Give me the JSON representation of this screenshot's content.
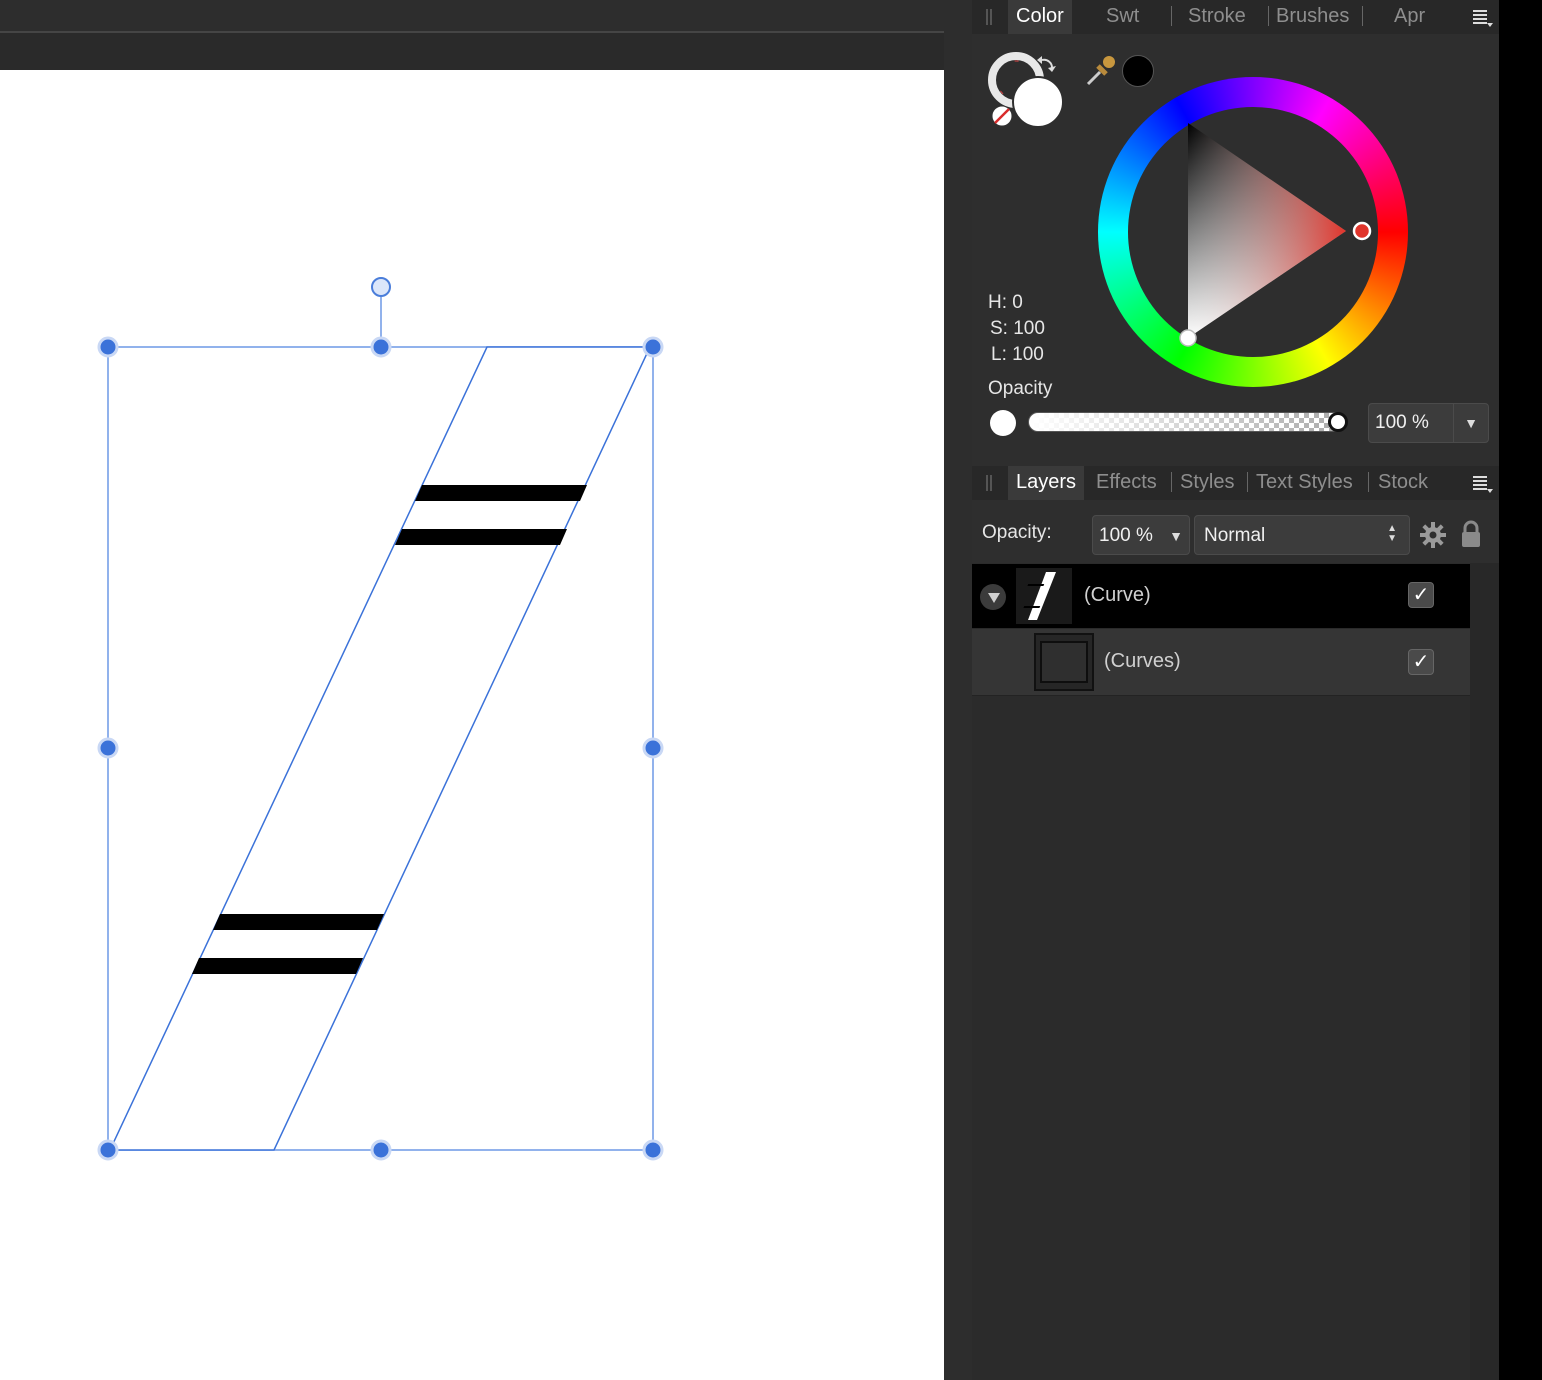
{
  "color_panel": {
    "tabs": [
      "Color",
      "Swt",
      "Stroke",
      "Brushes",
      "Apr"
    ],
    "hsl": {
      "h": "H: 0",
      "s": "S: 100",
      "l": "L: 100"
    },
    "opacity_label": "Opacity",
    "opacity_value": "100 %"
  },
  "layers_panel": {
    "tabs": [
      "Layers",
      "Effects",
      "Styles",
      "Text Styles",
      "Stock"
    ],
    "opacity_label": "Opacity:",
    "opacity_value": "100 %",
    "blend_mode": "Normal",
    "layers": [
      {
        "name": "(Curve)",
        "checked": "✓"
      },
      {
        "name": "(Curves)",
        "checked": "✓"
      }
    ]
  },
  "colors": {
    "accent": "#3b72d9",
    "panel_bg": "#2e2e2e",
    "hue_red": "#e0342b"
  }
}
